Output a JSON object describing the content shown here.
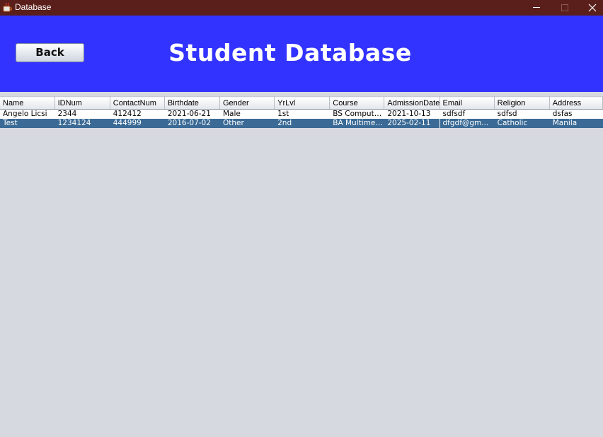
{
  "window": {
    "title": "Database",
    "icon": "java-cup-icon"
  },
  "header": {
    "back_label": "Back",
    "title": "Student Database",
    "background": "#3333ff"
  },
  "table": {
    "columns": [
      "Name",
      "IDNum",
      "ContactNum",
      "Birthdate",
      "Gender",
      "YrLvl",
      "Course",
      "AdmissionDate",
      "Email",
      "Religion",
      "Address"
    ],
    "rows": [
      [
        "Angelo Licsi",
        "2344",
        "412412",
        "2021-06-21",
        "Male",
        "1st",
        "BS Compute...",
        "2021-10-13",
        "sdfsdf",
        "sdfsd",
        "dsfas"
      ],
      [
        "Test",
        "1234124",
        "444999",
        "2016-07-02",
        "Other",
        "2nd",
        "BA Multimed...",
        "2025-02-11",
        "dfgdf@gm...",
        "Catholic",
        "Manila"
      ]
    ],
    "selected_row": 1,
    "selection_color": "#3a6a95"
  }
}
